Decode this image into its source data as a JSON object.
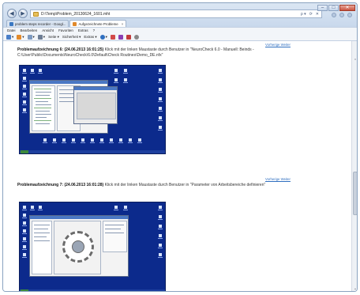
{
  "browser": {
    "address_url": "D:\\Temp\\Problem_20130624_1601.mht",
    "tabs": [
      {
        "label": "problem steps recorder - Googl...",
        "active": false
      },
      {
        "label": "Aufgezeichnete Probleme",
        "active": true
      }
    ],
    "tab_close_glyph": "×",
    "nav_back_glyph": "◀",
    "nav_forward_glyph": "▶",
    "address_actions": [
      "ρ ▾",
      "⟳",
      "✕"
    ],
    "window_controls": [
      "–",
      "□",
      "✕"
    ]
  },
  "menubar": {
    "items": [
      "Datei",
      "Bearbeiten",
      "Ansicht",
      "Favoriten",
      "Extras",
      "?"
    ]
  },
  "cmdbar": {
    "items": [
      {
        "label": "▾",
        "icon": "home-icon",
        "color": "#4a7fc9"
      },
      {
        "label": "▾",
        "icon": "feeds-icon",
        "color": "#e38a2b"
      },
      {
        "label": "▾",
        "icon": "mail-icon",
        "color": "#7d9ac0"
      },
      {
        "label": "▾",
        "icon": "print-icon",
        "color": "#6d7d94"
      },
      {
        "label": "Seite ▾",
        "icon": "",
        "color": ""
      },
      {
        "label": "Sicherheit ▾",
        "icon": "",
        "color": ""
      },
      {
        "label": "Extras ▾",
        "icon": "",
        "color": ""
      },
      {
        "label": "▾",
        "icon": "help-icon",
        "color": "#2f6fc0"
      },
      {
        "label": "",
        "icon": "research-icon",
        "color": "#d24a4a"
      },
      {
        "label": "",
        "icon": "onenote-icon",
        "color": "#8a3fb3"
      },
      {
        "label": "",
        "icon": "tool-icon",
        "color": "#c23b3b"
      },
      {
        "label": "",
        "icon": "settings-icon",
        "color": "#888888"
      }
    ]
  },
  "entries": [
    {
      "top_link": "Vorherige Weiter",
      "title": "Problemaufzeichnung 6: (24.06.2013 16:01:25)",
      "text": " Klick mit der linken Maustaste durch Benutzer in \"NeuroCheck 6.0 - Manuell: Beinds - C:\\User\\Public\\Documents\\NeuroCheck\\6.0\\Default\\Check Routines\\Demo_DE.nfx\""
    },
    {
      "top_link": "Vorherige Weiter",
      "title": "Problemaufzeichnung 7: (24.06.2013 16:01:28)",
      "text": " Klick mit der linken Maustaste durch Benutzer in \"Parameter von Arbeitsbereiche definieren\""
    }
  ],
  "scrollbar": {
    "up_glyph": "⌃",
    "down_glyph": "⌄"
  }
}
